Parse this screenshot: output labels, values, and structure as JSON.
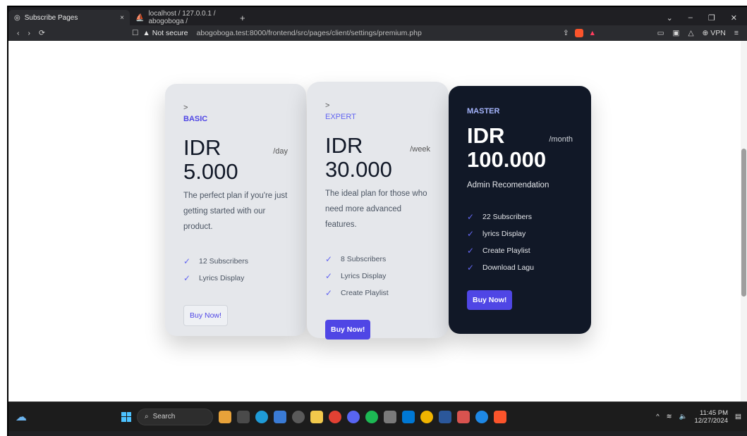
{
  "browser": {
    "active_tab": {
      "title": "Subscribe Pages",
      "close": "×"
    },
    "inactive_tab": {
      "title": "localhost / 127.0.0.1 / abogoboga /"
    },
    "new_tab": "+",
    "window_controls": [
      "⌄",
      "–",
      "❐",
      "✕"
    ],
    "nav": {
      "back": "‹",
      "forward": "›",
      "reload": "⟳"
    },
    "bookmark": "☐",
    "security_label": "▲ Not secure",
    "url": "abogoboga.test:8000/frontend/src/pages/client/settings/premium.php",
    "vpn_label": "⊕ VPN",
    "menu": "≡"
  },
  "plans": [
    {
      "arrow": ">",
      "tier": "BASIC",
      "price_line1": "IDR",
      "price_line2": "5.000",
      "period": "/day",
      "description": "The perfect plan if you're just getting started with our product.",
      "features": [
        "12 Subscribers",
        "Lyrics Display"
      ],
      "button": "Buy Now!"
    },
    {
      "arrow": ">",
      "tier": "EXPERT",
      "price_line1": "IDR",
      "price_line2": "30.000",
      "period": "/week",
      "description": "The ideal plan for those who need more advanced features.",
      "features": [
        "8 Subscribers",
        "Lyrics Display",
        "Create Playlist"
      ],
      "button": "Buy Now!"
    },
    {
      "tier": "MASTER",
      "price_line1": "IDR",
      "price_line2": "100.000",
      "period": "/month",
      "description": "Admin Recomendation",
      "features": [
        "22 Subscribers",
        "lyrics Display",
        "Create Playlist",
        "Download Lagu"
      ],
      "button": "Buy Now!"
    }
  ],
  "taskbar": {
    "search_label": "Search",
    "time": "11:45 PM",
    "date": "12/27/2024"
  },
  "colors": {
    "accent": "#4f46e5",
    "dark_card": "#111827",
    "light_card": "#e5e7eb"
  }
}
